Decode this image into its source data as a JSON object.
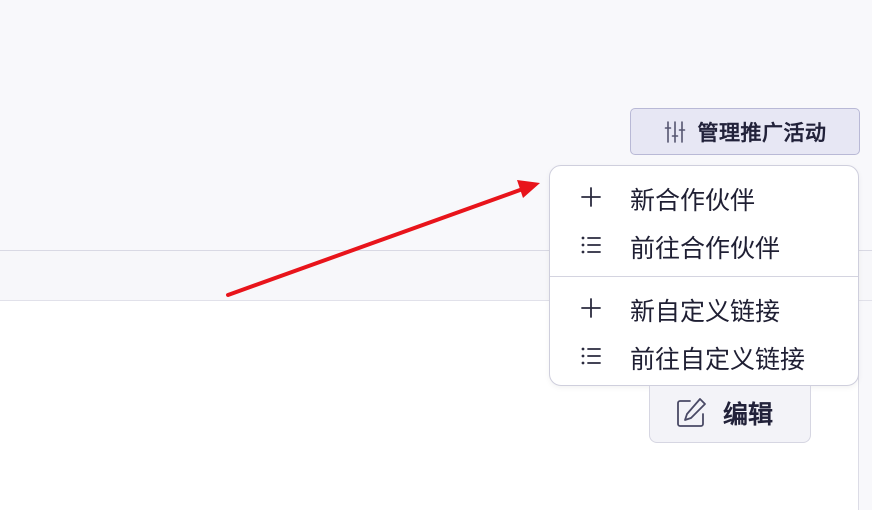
{
  "toolbar": {
    "manage_campaigns_label": "管理推广活动"
  },
  "dropdown": {
    "items": [
      {
        "label": "新合作伙伴",
        "icon": "plus-icon"
      },
      {
        "label": "前往合作伙伴",
        "icon": "list-icon"
      },
      {
        "label": "新自定义链接",
        "icon": "plus-icon"
      },
      {
        "label": "前往自定义链接",
        "icon": "list-icon"
      }
    ]
  },
  "edit": {
    "label": "编辑",
    "icon": "edit-icon"
  },
  "annotation": {
    "arrow_color": "#e8141b"
  },
  "colors": {
    "button_bg": "#e7e7f4",
    "button_border": "#b9b9d6",
    "text": "#1f1f33"
  }
}
